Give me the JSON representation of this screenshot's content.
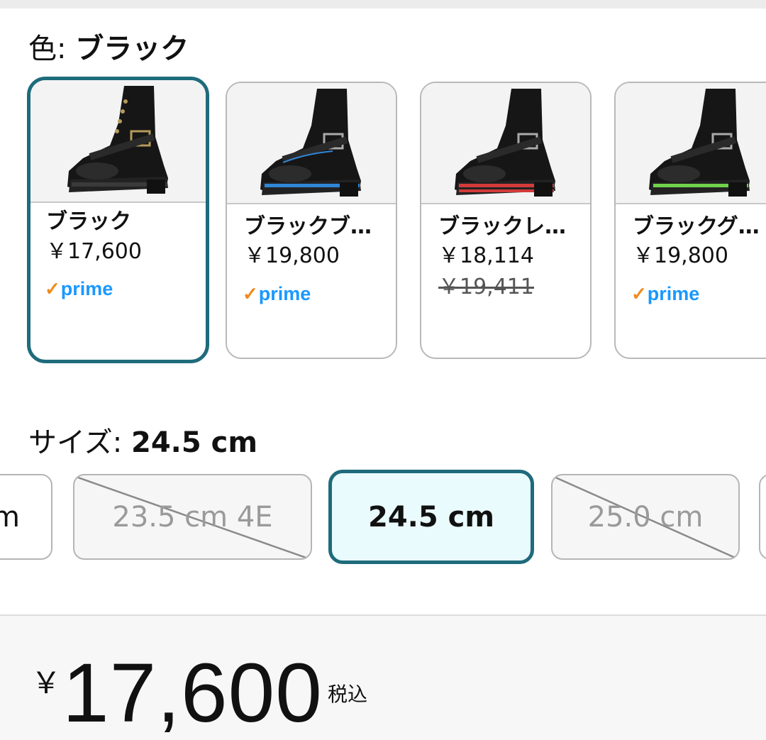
{
  "color_selector": {
    "label": "色: ",
    "selected_value": "ブラック",
    "options": [
      {
        "name": "ブラック",
        "price": "￥17,600",
        "prime": "prime",
        "stitch_color": "#3a3a3a"
      },
      {
        "name": "ブラックブ…",
        "price": "￥19,800",
        "prime": "prime",
        "stitch_color": "#2f86d6"
      },
      {
        "name": "ブラックレ…",
        "price": "￥18,114",
        "old_price": "￥19,411",
        "stitch_color": "#d33a3a"
      },
      {
        "name": "ブラックグ…",
        "price": "￥19,800",
        "prime": "prime",
        "stitch_color": "#6fd24a"
      }
    ]
  },
  "size_selector": {
    "label": "サイズ: ",
    "selected_value": "24.5 cm",
    "options": [
      {
        "label": "m",
        "state": "available"
      },
      {
        "label": "23.5 cm 4E",
        "state": "unavailable"
      },
      {
        "label": "24.5 cm",
        "state": "selected"
      },
      {
        "label": "25.0 cm",
        "state": "unavailable"
      }
    ]
  },
  "price": {
    "currency": "￥",
    "amount": "17,600",
    "tax_note": "税込"
  },
  "colors": {
    "selected_border": "#1e6b7b",
    "selected_bg": "#eafbfd",
    "prime_blue": "#1a98ff",
    "prime_check": "#f08a1c"
  }
}
